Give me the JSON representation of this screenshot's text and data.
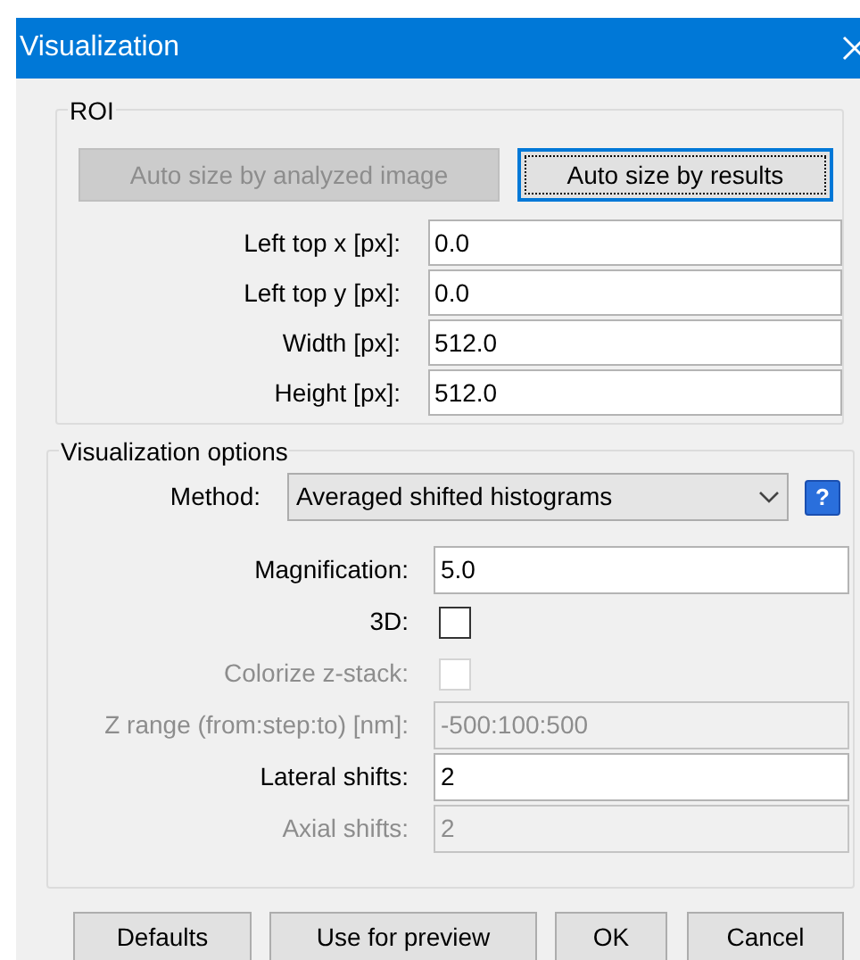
{
  "window": {
    "title": "Visualization"
  },
  "roi": {
    "title": "ROI",
    "buttons": [
      {
        "label": "Auto size by analyzed image",
        "disabled": true,
        "focused": false
      },
      {
        "label": "Auto size by results",
        "disabled": false,
        "focused": true
      }
    ],
    "fields": [
      {
        "label": "Left top x [px]:",
        "value": "0.0"
      },
      {
        "label": "Left top y [px]:",
        "value": "0.0"
      },
      {
        "label": "Width [px]:",
        "value": "512.0"
      },
      {
        "label": "Height [px]:",
        "value": "512.0"
      }
    ]
  },
  "options": {
    "title": "Visualization options",
    "method": {
      "label": "Method:",
      "value": "Averaged shifted histograms",
      "help": "?"
    },
    "fields": [
      {
        "kind": "text",
        "label": "Magnification:",
        "value": "5.0",
        "disabled": false
      },
      {
        "kind": "checkbox",
        "label": "3D:",
        "checked": false,
        "disabled": false
      },
      {
        "kind": "checkbox",
        "label": "Colorize z-stack:",
        "checked": false,
        "disabled": true
      },
      {
        "kind": "text",
        "label": "Z range (from:step:to) [nm]:",
        "value": "-500:100:500",
        "disabled": true
      },
      {
        "kind": "text",
        "label": "Lateral shifts:",
        "value": "2",
        "disabled": false
      },
      {
        "kind": "text",
        "label": "Axial shifts:",
        "value": "2",
        "disabled": true
      }
    ]
  },
  "buttons": [
    "Defaults",
    "Use for preview",
    "OK",
    "Cancel"
  ]
}
